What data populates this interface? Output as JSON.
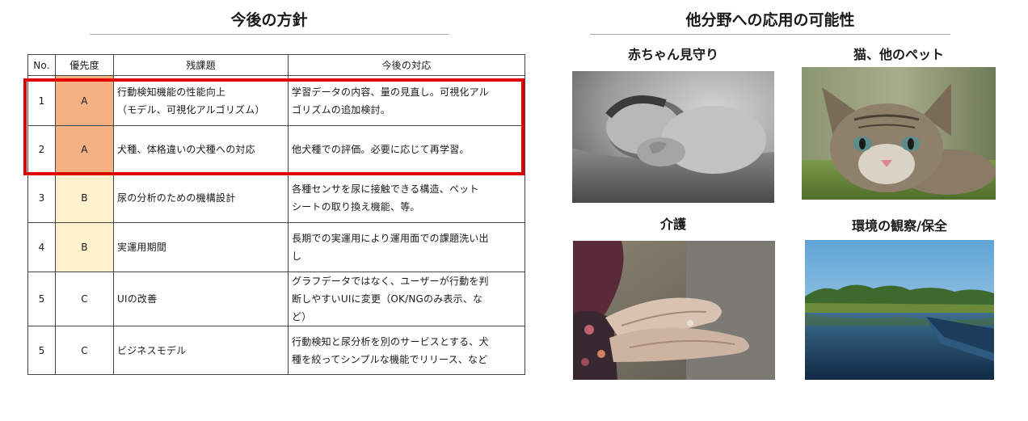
{
  "left_section": {
    "title": "今後の方針",
    "table": {
      "headers": [
        "No.",
        "優先度",
        "残課題",
        "今後の対応"
      ],
      "rows": [
        {
          "no": "1",
          "priority": "A",
          "issue": "行動検知機能の性能向上\n（モデル、可視化アルゴリズム）",
          "action": "学習データの内容、量の見直し。可視化アル\nゴリズムの追加検討。",
          "color": "#f4b183"
        },
        {
          "no": "2",
          "priority": "A",
          "issue": "犬種、体格違いの犬種への対応",
          "action": "他犬種での評価。必要に応じて再学習。",
          "color": "#f4b183"
        },
        {
          "no": "3",
          "priority": "B",
          "issue": "尿の分析のための機構設計",
          "action": "各種センサを尿に接触できる構造、ペット\nシートの取り換え機能、等。",
          "color": "#fff2cc"
        },
        {
          "no": "4",
          "priority": "B",
          "issue": "実運用期間",
          "action": "長期での実運用により運用面での課題洗い出\nし",
          "color": "#fff2cc"
        },
        {
          "no": "5",
          "priority": "C",
          "issue": "UIの改善",
          "action": "グラフデータではなく、ユーザーが行動を判\n断しやすいUIに変更（OK/NGのみ表示、な\nど）",
          "color": "#ffffff"
        },
        {
          "no": "5",
          "priority": "C",
          "issue": "ビジネスモデル",
          "action": "行動検知と尿分析を別のサービスとする、犬\n種を絞ってシンプルな機能でリリース、など",
          "color": "#ffffff"
        }
      ]
    },
    "highlight_color": "#e00000"
  },
  "right_section": {
    "title": "他分野への応用の可能性",
    "photos": [
      {
        "label": "赤ちゃん見守り"
      },
      {
        "label": "猫、他のペット"
      },
      {
        "label": "介護"
      },
      {
        "label": "環境の観察/保全"
      }
    ]
  }
}
